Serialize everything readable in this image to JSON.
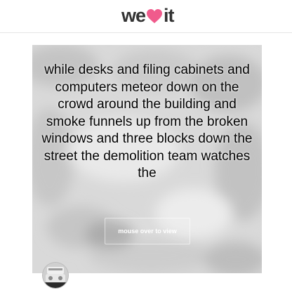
{
  "header": {
    "logo_prefix": "we",
    "logo_suffix": "it",
    "heart_icon": "heart-icon",
    "heart_color": "#f05b8c"
  },
  "card": {
    "quote": "while desks and filing cabinets and computers meteor down on the crowd around the building and smoke funnels up from the broken windows and three blocks down the street the demolition team watches the",
    "overlay_label": "mouse over to view"
  },
  "user": {
    "avatar_icon": "user-avatar"
  }
}
